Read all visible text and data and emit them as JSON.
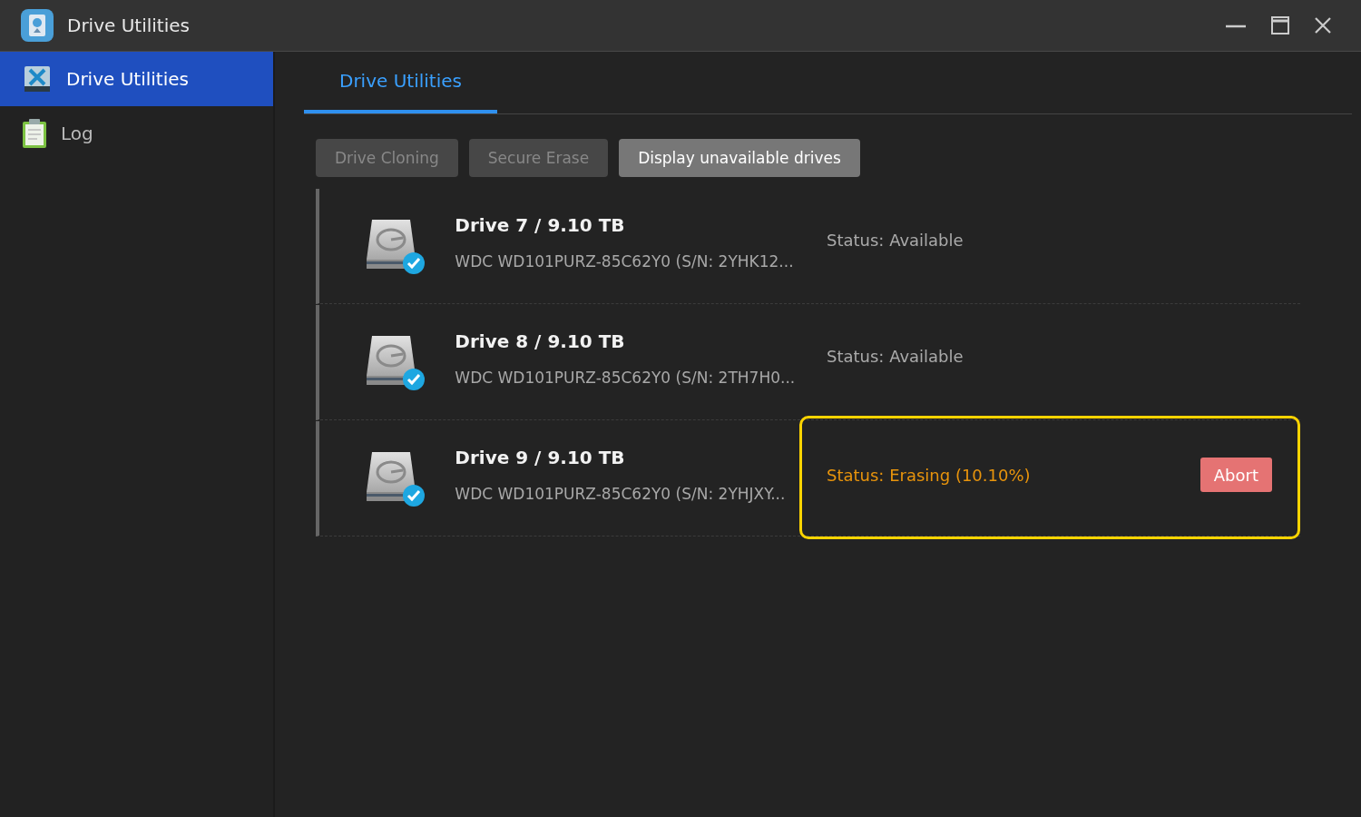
{
  "window": {
    "title": "Drive Utilities"
  },
  "sidebar": {
    "items": [
      {
        "label": "Drive Utilities",
        "selected": true,
        "kind": "utilities"
      },
      {
        "label": "Log",
        "selected": false,
        "kind": "log"
      }
    ]
  },
  "tabs": [
    {
      "label": "Drive Utilities",
      "selected": true
    }
  ],
  "toolbar": [
    {
      "label": "Drive Cloning",
      "disabled": true
    },
    {
      "label": "Secure Erase",
      "disabled": true
    },
    {
      "label": "Display unavailable drives",
      "disabled": false
    }
  ],
  "drives": [
    {
      "name": "Drive 7 / 9.10 TB",
      "model": "WDC WD101PURZ-85C62Y0 (S/N: 2YHK12...",
      "status": "Status: Available",
      "kind": "available",
      "highlighted": false
    },
    {
      "name": "Drive 8 / 9.10 TB",
      "model": "WDC WD101PURZ-85C62Y0 (S/N: 2TH7H0...",
      "status": "Status: Available",
      "kind": "available",
      "highlighted": false
    },
    {
      "name": "Drive 9 / 9.10 TB",
      "model": "WDC WD101PURZ-85C62Y0 (S/N: 2YHJXY...",
      "status": "Status: Erasing (10.10%)",
      "kind": "erasing",
      "highlighted": true,
      "action": "Abort"
    }
  ]
}
